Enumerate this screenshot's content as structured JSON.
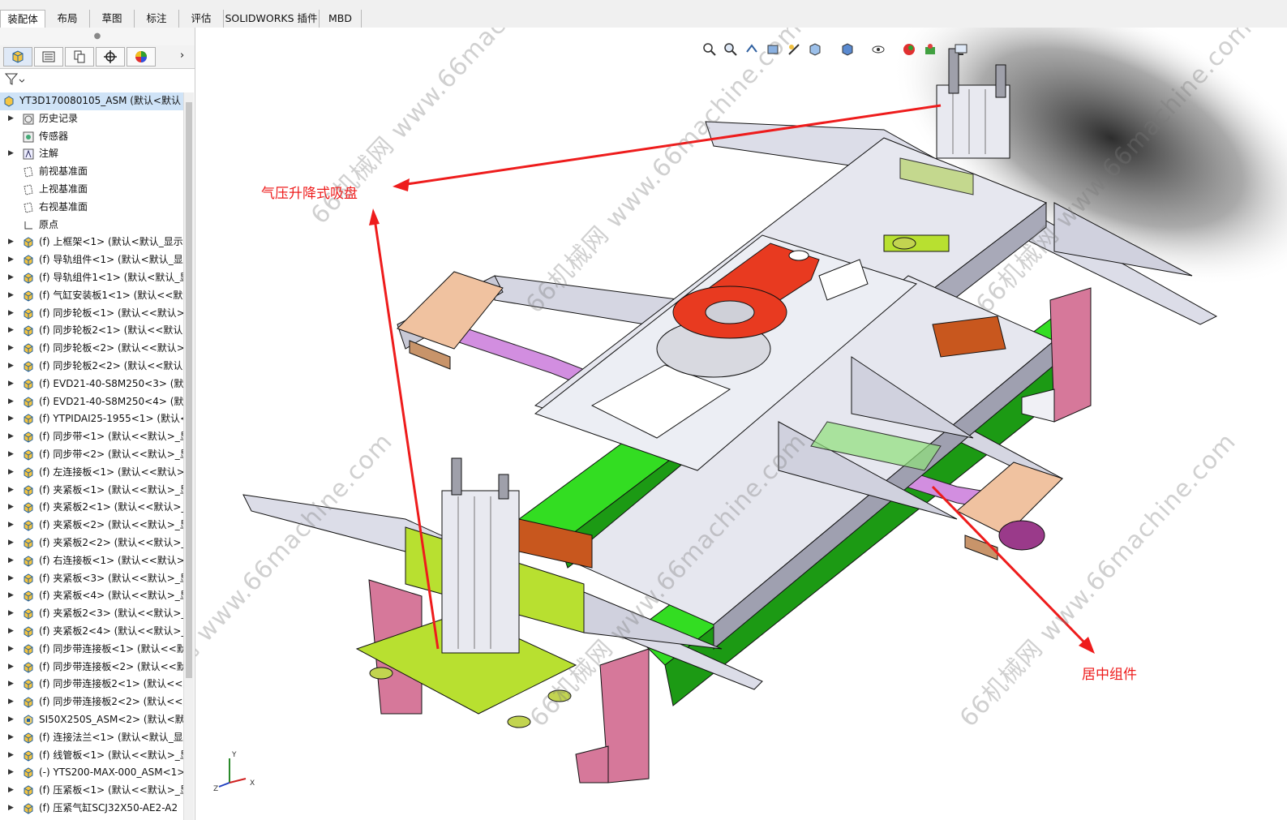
{
  "command_tabs": [
    "装配体",
    "布局",
    "草图",
    "标注",
    "评估",
    "SOLIDWORKS 插件",
    "MBD"
  ],
  "active_tab": "装配体",
  "top_partial_label": "体",
  "panel_tabs": [
    "feature-manager-icon",
    "property-manager-icon",
    "configuration-manager-icon",
    "dimxpert-icon",
    "display-manager-icon"
  ],
  "tree": {
    "root": "YT3D170080105_ASM (默认<默认",
    "items": [
      {
        "label": "历史记录",
        "icon": "history-icon",
        "expand": true
      },
      {
        "label": "传感器",
        "icon": "sensor-icon",
        "expand": false
      },
      {
        "label": "注解",
        "icon": "annotation-icon",
        "expand": true
      },
      {
        "label": "前视基准面",
        "icon": "plane-icon",
        "expand": false
      },
      {
        "label": "上视基准面",
        "icon": "plane-icon",
        "expand": false
      },
      {
        "label": "右视基准面",
        "icon": "plane-icon",
        "expand": false
      },
      {
        "label": "原点",
        "icon": "origin-icon",
        "expand": false
      },
      {
        "label": "(f) 上框架<1> (默认<默认_显示",
        "icon": "part-icon",
        "expand": true
      },
      {
        "label": "(f) 导轨组件<1> (默认<默认_显",
        "icon": "part-icon",
        "expand": true
      },
      {
        "label": "(f) 导轨组件1<1> (默认<默认_显",
        "icon": "part-icon",
        "expand": true
      },
      {
        "label": "(f) 气缸安装板1<1> (默认<<默认",
        "icon": "part-icon",
        "expand": true
      },
      {
        "label": "(f) 同步轮板<1> (默认<<默认>_",
        "icon": "part-icon",
        "expand": true
      },
      {
        "label": "(f) 同步轮板2<1> (默认<<默认>",
        "icon": "part-icon",
        "expand": true
      },
      {
        "label": "(f) 同步轮板<2> (默认<<默认>_",
        "icon": "part-icon",
        "expand": true
      },
      {
        "label": "(f) 同步轮板2<2> (默认<<默认>",
        "icon": "part-icon",
        "expand": true
      },
      {
        "label": "(f) EVD21-40-S8M250<3> (默认",
        "icon": "part-icon",
        "expand": true
      },
      {
        "label": "(f) EVD21-40-S8M250<4> (默认",
        "icon": "part-icon",
        "expand": true
      },
      {
        "label": "(f) YTPIDAI25-1955<1> (默认<",
        "icon": "part-icon",
        "expand": true
      },
      {
        "label": "(f) 同步带<1> (默认<<默认>_显",
        "icon": "part-icon",
        "expand": true
      },
      {
        "label": "(f) 同步带<2> (默认<<默认>_显",
        "icon": "part-icon",
        "expand": true
      },
      {
        "label": "(f) 左连接板<1> (默认<<默认>_",
        "icon": "part-icon",
        "expand": true
      },
      {
        "label": "(f) 夹紧板<1> (默认<<默认>_显",
        "icon": "part-icon",
        "expand": true
      },
      {
        "label": "(f) 夹紧板2<1> (默认<<默认>_显",
        "icon": "part-icon",
        "expand": true
      },
      {
        "label": "(f) 夹紧板<2> (默认<<默认>_显",
        "icon": "part-icon",
        "expand": true
      },
      {
        "label": "(f) 夹紧板2<2> (默认<<默认>_显",
        "icon": "part-icon",
        "expand": true
      },
      {
        "label": "(f) 右连接板<1> (默认<<默认>_",
        "icon": "part-icon",
        "expand": true
      },
      {
        "label": "(f) 夹紧板<3> (默认<<默认>_显",
        "icon": "part-icon",
        "expand": true
      },
      {
        "label": "(f) 夹紧板<4> (默认<<默认>_显",
        "icon": "part-icon",
        "expand": true
      },
      {
        "label": "(f) 夹紧板2<3> (默认<<默认>_显",
        "icon": "part-icon",
        "expand": true
      },
      {
        "label": "(f) 夹紧板2<4> (默认<<默认>_显",
        "icon": "part-icon",
        "expand": true
      },
      {
        "label": "(f) 同步带连接板<1> (默认<<默",
        "icon": "part-icon",
        "expand": true
      },
      {
        "label": "(f) 同步带连接板<2> (默认<<默",
        "icon": "part-icon",
        "expand": true
      },
      {
        "label": "(f) 同步带连接板2<1> (默认<<默",
        "icon": "part-icon",
        "expand": true
      },
      {
        "label": "(f) 同步带连接板2<2> (默认<<默",
        "icon": "part-icon",
        "expand": true
      },
      {
        "label": "SI50X250S_ASM<2> (默认<默",
        "icon": "subassembly-icon",
        "expand": true
      },
      {
        "label": "(f) 连接法兰<1> (默认<默认_显",
        "icon": "part-icon",
        "expand": true
      },
      {
        "label": "(f) 线管板<1> (默认<<默认>_显",
        "icon": "part-icon",
        "expand": true
      },
      {
        "label": "(-) YTS200-MAX-000_ASM<1>",
        "icon": "part-icon",
        "expand": true
      },
      {
        "label": "(f) 压紧板<1> (默认<<默认>_显",
        "icon": "part-icon",
        "expand": true
      },
      {
        "label": "(f) 压紧气缸SCJ32X50-AE2-A2",
        "icon": "part-icon",
        "expand": true
      }
    ]
  },
  "view_toolbar_icons": [
    "zoom-to-fit-icon",
    "zoom-area-icon",
    "previous-view-icon",
    "section-view-icon",
    "dynamic-annotation-icon",
    "view-orientation-icon",
    "display-style-icon",
    "hide-show-icon",
    "edit-appearance-icon",
    "apply-scene-icon",
    "view-settings-icon"
  ],
  "annotations": {
    "callout_top": "气压升降式吸盘",
    "callout_right": "居中组件"
  },
  "watermark": "66机械网 www.66machine.com",
  "triad_axes": [
    "X",
    "Y",
    "Z"
  ],
  "colors": {
    "frame_gray": "#d9dae6",
    "green_beam": "#33dd22",
    "pink_plate": "#d6789a",
    "orange_plate": "#e0a070",
    "red_flange": "#e83a20",
    "lime_plate": "#b8e030",
    "brown_block": "#c8571e",
    "purple_belt": "#c060d0",
    "annotation_red": "#ee1c1c",
    "selection_blue": "#cfe3f7"
  }
}
